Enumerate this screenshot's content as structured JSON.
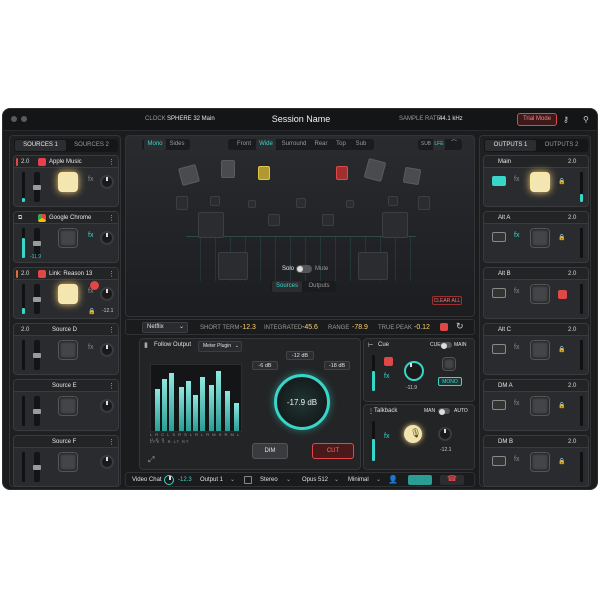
{
  "titlebar": {
    "clock_label": "CLOCK",
    "clock_value": "SPHERE 32 Main",
    "session_name": "Session Name",
    "sample_rate_label": "SAMPLE RATE",
    "sample_rate_value": "44.1 kHz",
    "trial_label": "Trial Mode"
  },
  "sources": {
    "tabs": [
      "SOURCES 1",
      "SOURCES 2"
    ],
    "strips": [
      {
        "num": "2.0",
        "name": "Apple Music",
        "value": "",
        "accent": "#e04848"
      },
      {
        "num": "",
        "name": "Google Chrome",
        "value": "-11.9",
        "accent": "#888888"
      },
      {
        "num": "2.0",
        "name": "Link: Reason 13",
        "value": "-12.1",
        "accent": "#e07030"
      },
      {
        "num": "2.0",
        "name": "Source D",
        "value": "",
        "accent": ""
      },
      {
        "num": "",
        "name": "Source E",
        "value": "",
        "accent": ""
      },
      {
        "num": "",
        "name": "Source F",
        "value": "",
        "accent": ""
      }
    ]
  },
  "outputs": {
    "tabs": [
      "OUTPUTS 1",
      "OUTPUTS 2"
    ],
    "strips": [
      {
        "name": "Main",
        "num": "2.0"
      },
      {
        "name": "Alt A",
        "num": "2.0"
      },
      {
        "name": "Alt B",
        "num": "2.0"
      },
      {
        "name": "Alt C",
        "num": "2.0"
      },
      {
        "name": "DM A",
        "num": "2.0"
      },
      {
        "name": "DM B",
        "num": "2.0"
      }
    ]
  },
  "stage": {
    "mode_tabs": [
      "Mono",
      "Sides"
    ],
    "view_tabs": [
      "Front",
      "Wide",
      "Surround",
      "Rear",
      "Top",
      "Sub"
    ],
    "active_view": "Wide",
    "sub_tabs": [
      "SUB",
      "LFE"
    ],
    "solo_label": "Solo",
    "mute_label": "Mute",
    "bottom_tabs": [
      "Sources",
      "Outputs"
    ],
    "clear_all": "CLEAR ALL"
  },
  "loudness": {
    "preset": "Netflix",
    "short_term_label": "SHORT TERM",
    "short_term_value": "-12.3",
    "integrated_label": "INTEGRATED",
    "integrated_value": "-45.6",
    "range_label": "RANGE",
    "range_value": "-78.9",
    "true_peak_label": "TRUE PEAK",
    "true_peak_value": "-0.12"
  },
  "monitor": {
    "follow_label": "Follow Output",
    "meter_select": "Meter Plugin",
    "channel_labels": "L R C   L S R S L R   L R   M S R   M   L U F S",
    "lfe_labels": "LFE   L     R     LT    RT",
    "db_buttons": [
      "-6 dB",
      "-12 dB",
      "-18 dB"
    ],
    "level": "-17.9 dB",
    "dim_label": "DIM",
    "cut_label": "CUT"
  },
  "cue": {
    "title": "Cue",
    "cue_label": "CUE",
    "main_label": "MAIN",
    "value": "-11.9",
    "mono": "MONO"
  },
  "talkback": {
    "title": "Talkback",
    "manual": "MAN",
    "auto": "AUTO",
    "value": "-12.1"
  },
  "bottom_bar": {
    "video_chat": "Video Chat",
    "video_value": "-12.3",
    "output": "Output 1",
    "format": "Stereo",
    "codec": "Opus 512",
    "quality": "Minimal"
  },
  "colors": {
    "accent": "#38d6c8",
    "warning": "#e04848",
    "highlight": "#ffd070"
  }
}
